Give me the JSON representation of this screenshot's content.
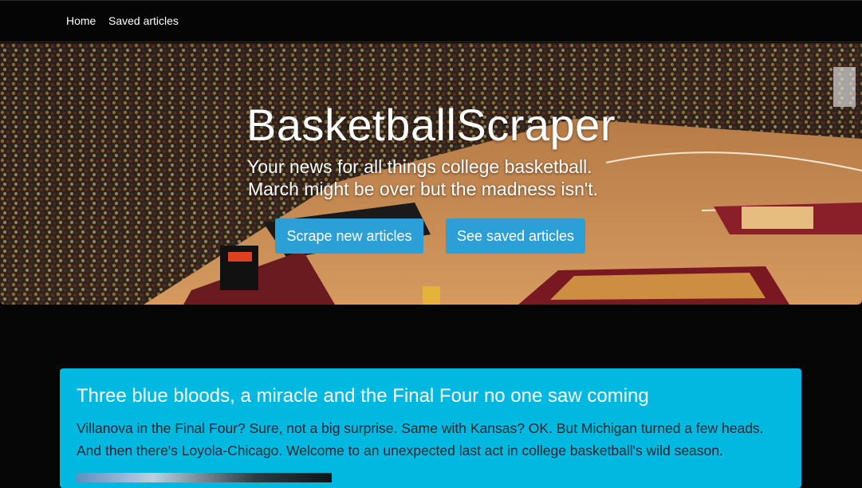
{
  "nav": {
    "home_label": "Home",
    "saved_label": "Saved articles"
  },
  "hero": {
    "title": "BasketballScraper",
    "tagline_line1": "Your news for all things college basketball.",
    "tagline_line2": "March might be over but the madness isn't.",
    "scrape_button": "Scrape new articles",
    "saved_button": "See saved articles"
  },
  "article": {
    "title": "Three blue bloods, a miracle and the Final Four no one saw coming",
    "summary": "Villanova in the Final Four? Sure, not a big surprise. Same with Kansas? OK. But Michigan turned a few heads. And then there's Loyola-Chicago. Welcome to an unexpected last act in college basketball's wild season."
  },
  "colors": {
    "button": "#2b9fd6",
    "card": "#00b8e0",
    "background": "#060606"
  }
}
